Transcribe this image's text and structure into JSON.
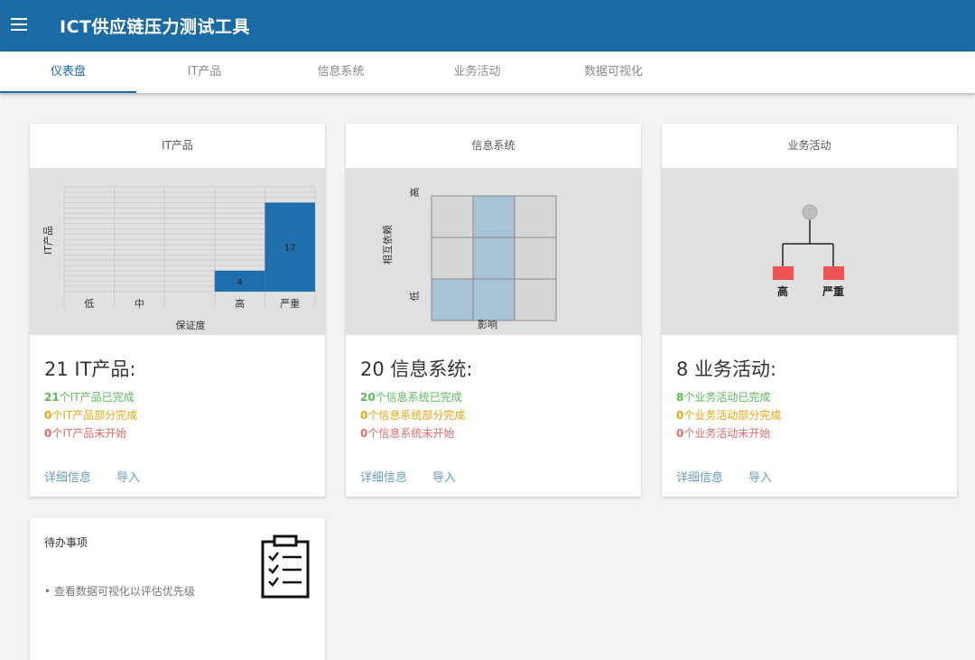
{
  "app": {
    "title": "ICT供应链压力测试工具"
  },
  "tabs": [
    {
      "label": "仪表盘"
    },
    {
      "label": "IT产品"
    },
    {
      "label": "信息系统"
    },
    {
      "label": "业务活动"
    },
    {
      "label": "数据可视化"
    }
  ],
  "cards": {
    "it": {
      "header": "IT产品",
      "count": "21 IT产品:",
      "complete_num": "21",
      "complete_text": "个IT产品已完成",
      "partial_num": "0",
      "partial_text": "个IT产品部分完成",
      "notstarted_num": "0",
      "notstarted_text": "个IT产品未开始",
      "details_label": "详细信息",
      "import_label": "导入"
    },
    "systems": {
      "header": "信息系统",
      "count": "20 信息系统:",
      "complete_num": "20",
      "complete_text": "个信息系统已完成",
      "partial_num": "0",
      "partial_text": "个信息系统部分完成",
      "notstarted_num": "0",
      "notstarted_text": "个信息系统未开始",
      "details_label": "详细信息",
      "import_label": "导入"
    },
    "activities": {
      "header": "业务活动",
      "count": "8 业务活动:",
      "complete_num": "8",
      "complete_text": "个业务活动已完成",
      "partial_num": "0",
      "partial_text": "个业务活动部分完成",
      "notstarted_num": "0",
      "notstarted_text": "个业务活动未开始",
      "details_label": "详细信息",
      "import_label": "导入"
    }
  },
  "todo": {
    "title": "待办事项",
    "items": [
      "• 查看数据可视化以评估优先级"
    ]
  },
  "chart_data": [
    {
      "type": "bar",
      "categories": [
        "低",
        "中",
        "",
        "高",
        "严重"
      ],
      "values": [
        0,
        0,
        0,
        4,
        17
      ],
      "data_labels": [
        "",
        "",
        "",
        "4",
        "17"
      ],
      "xlabel": "保证度",
      "ylabel": "IT产品",
      "ylim": [
        0,
        20
      ],
      "grid": true,
      "color": "#1f6fad"
    },
    {
      "type": "heatmap",
      "xlabel": "影响",
      "ylabel": "相互依赖",
      "y_tick_labels": [
        "高",
        "低"
      ],
      "rows": 3,
      "cols": 3,
      "cells": [
        [
          0,
          1,
          0
        ],
        [
          0,
          1,
          0
        ],
        [
          1,
          1,
          0
        ]
      ],
      "colors": [
        "#d6d6d6",
        "#a9c3d6"
      ]
    },
    {
      "type": "tree",
      "root_color": "#bdbdbd",
      "leaves": [
        {
          "label": "高",
          "color": "#ef5353"
        },
        {
          "label": "严重",
          "color": "#ef5353"
        }
      ]
    }
  ]
}
